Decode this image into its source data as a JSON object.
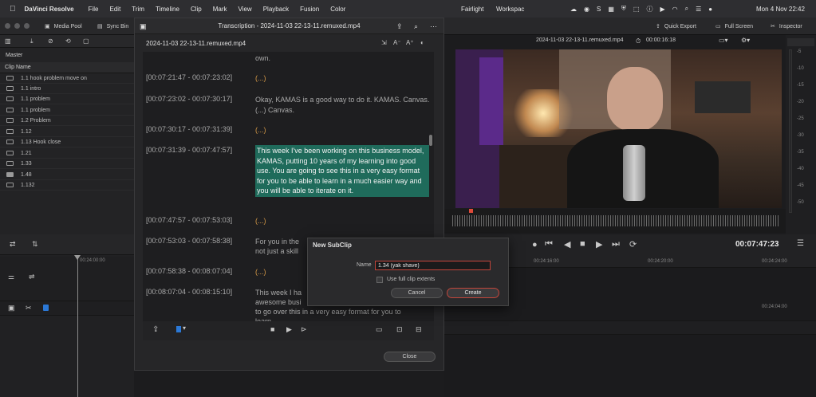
{
  "menubar": {
    "app": "DaVinci Resolve",
    "items": [
      "File",
      "Edit",
      "Trim",
      "Timeline",
      "Clip",
      "Mark",
      "View",
      "Playback",
      "Fusion",
      "Color"
    ],
    "center_items": [
      "Fairlight",
      "Workspac"
    ],
    "clock": "Mon 4 Nov  22:42"
  },
  "toolbar": {
    "media_pool": "Media Pool",
    "sync_bin": "Sync Bin",
    "quick_export": "Quick Export",
    "full_screen": "Full Screen",
    "inspector": "Inspector"
  },
  "mediapool": {
    "header": "Master",
    "column": "Clip Name",
    "clips": [
      "1.1 hook problem move on",
      "1.1 intro",
      "1.1 problem",
      "1.1 problem",
      "1.2 Problem",
      "1.12",
      "1.13 Hook close",
      "1.21",
      "1.33",
      "1.48",
      "1.132"
    ]
  },
  "transcription": {
    "title": "Transcription - 2024-11-03 22-13-11.remuxed.mp4",
    "filename": "2024-11-03 22-13-11.remuxed.mp4",
    "close_label": "Close",
    "entries": [
      {
        "ts": "",
        "text": "own."
      },
      {
        "ts": "[00:07:21:47 - 00:07:23:02]",
        "text": "(...)"
      },
      {
        "ts": "[00:07:23:02 - 00:07:30:17]",
        "text": "Okay, KAMAS is a good way to do it. KAMAS. Canvas. (...) Canvas."
      },
      {
        "ts": "[00:07:30:17 - 00:07:31:39]",
        "text": "(...)"
      },
      {
        "ts": "[00:07:31:39 - 00:07:47:57]",
        "text": "This week I've been working on this business model, KAMAS, putting 10 years of my learning into good use. You are going to see this in a very easy format for you to be able to learn in a much easier way and you will be able to iterate on it."
      },
      {
        "ts": "[00:07:47:57 - 00:07:53:03]",
        "text": "(...)"
      },
      {
        "ts": "[00:07:53:03 - 00:07:58:38]",
        "text": "For you in the"
      },
      {
        "ts": "",
        "text": "not just a skill"
      },
      {
        "ts": "[00:07:58:38 - 00:08:07:04]",
        "text": "(...)"
      },
      {
        "ts": "[00:08:07:04 - 00:08:15:10]",
        "text": "This week I ha"
      },
      {
        "ts": "",
        "text": "awesome busi"
      },
      {
        "ts": "",
        "text": "to go over this in a very easy format for you to"
      },
      {
        "ts": "",
        "text": "learn"
      }
    ]
  },
  "viewer": {
    "filename": "2024-11-03 22-13-11.remuxed.mp4",
    "duration": "00:00:16:18",
    "timecode": "00:07:47:23",
    "meter_labels": [
      "-5",
      "-10",
      "-15",
      "-20",
      "-25",
      "-30",
      "-35",
      "-40",
      "-45",
      "-50"
    ]
  },
  "timeline": {
    "ruler": [
      "00:24:00:00",
      "00:24:16:00",
      "00:24:20:00",
      "00:24:24:00"
    ],
    "track_time": "00:24:04:00"
  },
  "dialog": {
    "title": "New SubClip",
    "name_label": "Name",
    "name_value": "1.34 (yak shave)",
    "checkbox_label": "Use full clip extents",
    "cancel": "Cancel",
    "create": "Create"
  },
  "colors": {
    "highlight": "#1f6b5b",
    "accent": "#d69a47",
    "create_border": "#c2453a",
    "playhead": "#e04a3a"
  }
}
